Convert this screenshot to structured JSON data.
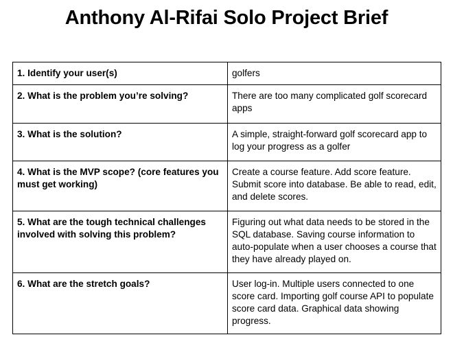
{
  "document": {
    "title": "Anthony Al-Rifai Solo Project Brief"
  },
  "brief": {
    "rows": [
      {
        "question": "1. Identify your user(s)",
        "answer": "golfers"
      },
      {
        "question": "2. What is the problem you’re solving?",
        "answer": "There are too many complicated golf scorecard apps"
      },
      {
        "question": "3. What is the solution?",
        "answer": "A simple, straight-forward golf scorecard app to log your progress as a golfer"
      },
      {
        "question": "4. What is the MVP scope? (core features you must get working)",
        "answer": "Create a course feature. Add score feature. Submit score into database. Be able to read, edit, and delete scores."
      },
      {
        "question": "5. What are the tough technical challenges involved with solving this problem?",
        "answer": "Figuring out what data needs to be stored in the SQL database. Saving course information to auto-populate when a user chooses a course that they have already played on."
      },
      {
        "question": "6. What are the stretch goals?",
        "answer": "User log-in. Multiple users connected to one score card. Importing golf course API to populate score card data. Graphical data showing progress."
      }
    ]
  }
}
